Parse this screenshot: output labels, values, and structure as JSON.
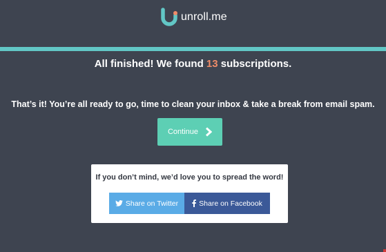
{
  "brand": {
    "name": "unroll.me",
    "logo_icon": "unrollme-logo-icon",
    "logo_colors": [
      "#62c7c6",
      "#ef8c69"
    ]
  },
  "colors": {
    "background": "#3e4450",
    "accent_bar": "#62c7c6",
    "highlight": "#ef8c69",
    "continue_button": "#5dcfb4",
    "twitter": "#5aabe6",
    "facebook": "#3b5998"
  },
  "headline": {
    "prefix": "All finished! We found",
    "count": "13",
    "suffix": "subscriptions."
  },
  "subtext": "That’s it! You’re all ready to go, time to clean your inbox & take a break from email spam.",
  "continue": {
    "label": "Continue",
    "icon": "chevron-right-icon"
  },
  "share": {
    "title": "If you don’t mind, we’d love you to spread the word!",
    "twitter_label": "Share on Twitter",
    "twitter_icon": "twitter-icon",
    "facebook_label": "Share on Facebook",
    "facebook_icon": "facebook-icon"
  }
}
